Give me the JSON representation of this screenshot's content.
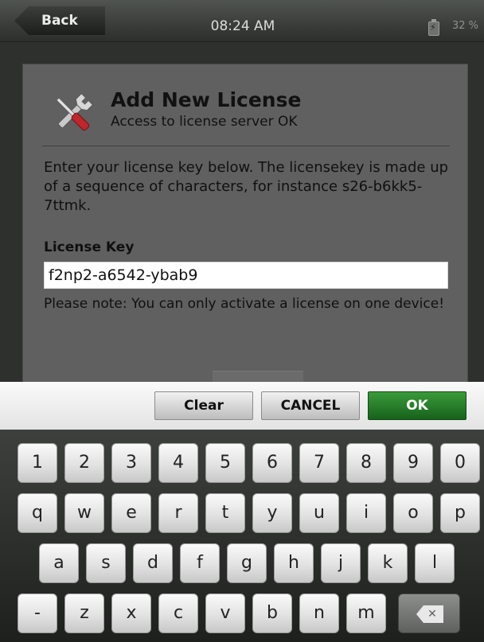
{
  "status_bar": {
    "back_label": "Back",
    "time": "08:24 AM",
    "battery_percent": "32 %"
  },
  "dialog": {
    "title": "Add New License",
    "subtitle": "Access to license server OK",
    "instructions": "Enter your license key below. The licensekey is made up of a sequence of characters, for instance s26-b6kk5-7ttmk.",
    "field_label": "License Key",
    "field_value": "f2np2-a6542-ybab9",
    "note": "Please note: You can only activate a license on one device!"
  },
  "actions": {
    "clear": "Clear",
    "cancel": "CANCEL",
    "ok": "OK"
  },
  "keyboard": {
    "row1": [
      "1",
      "2",
      "3",
      "4",
      "5",
      "6",
      "7",
      "8",
      "9",
      "0"
    ],
    "row2": [
      "q",
      "w",
      "e",
      "r",
      "t",
      "y",
      "u",
      "i",
      "o",
      "p"
    ],
    "row3": [
      "a",
      "s",
      "d",
      "f",
      "g",
      "h",
      "j",
      "k",
      "l"
    ],
    "row4": [
      "-",
      "z",
      "x",
      "c",
      "v",
      "b",
      "n",
      "m"
    ]
  },
  "colors": {
    "ok_green": "#1f7a24",
    "dialog_bg": "#5f605f"
  },
  "icons": {
    "back": "back-arrow-button",
    "battery": "battery-charging-icon",
    "tools": "wrench-screwdriver-icon",
    "delete": "backspace-icon"
  }
}
